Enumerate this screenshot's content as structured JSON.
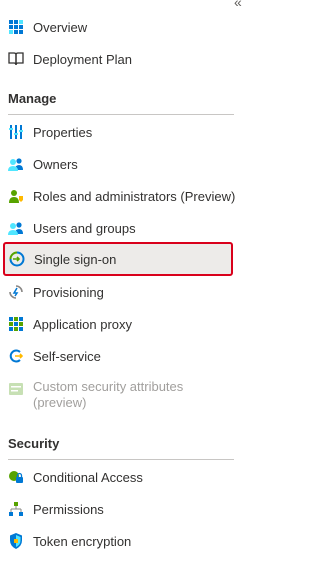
{
  "collapse_glyph": "«",
  "top_items": [
    {
      "label": "Overview",
      "icon": "grid-icon"
    },
    {
      "label": "Deployment Plan",
      "icon": "book-icon"
    }
  ],
  "manage": {
    "heading": "Manage",
    "items": [
      {
        "label": "Properties",
        "icon": "properties-icon"
      },
      {
        "label": "Owners",
        "icon": "owners-icon"
      },
      {
        "label": "Roles and administrators (Preview)",
        "icon": "roles-icon"
      },
      {
        "label": "Users and groups",
        "icon": "users-groups-icon"
      },
      {
        "label": "Single sign-on",
        "icon": "sso-icon",
        "selected": true
      },
      {
        "label": "Provisioning",
        "icon": "provisioning-icon"
      },
      {
        "label": "Application proxy",
        "icon": "app-proxy-icon"
      },
      {
        "label": "Self-service",
        "icon": "self-service-icon"
      },
      {
        "label": "Custom security attributes (preview)",
        "icon": "custom-attributes-icon",
        "disabled": true
      }
    ]
  },
  "security": {
    "heading": "Security",
    "items": [
      {
        "label": "Conditional Access",
        "icon": "conditional-access-icon"
      },
      {
        "label": "Permissions",
        "icon": "permissions-icon"
      },
      {
        "label": "Token encryption",
        "icon": "shield-icon"
      }
    ]
  },
  "colors": {
    "accent_blue": "#0078d4",
    "highlight_border": "#d9001b",
    "selected_bg": "#edebe9",
    "green": "#57a300",
    "disabled_text": "#a19f9d"
  }
}
